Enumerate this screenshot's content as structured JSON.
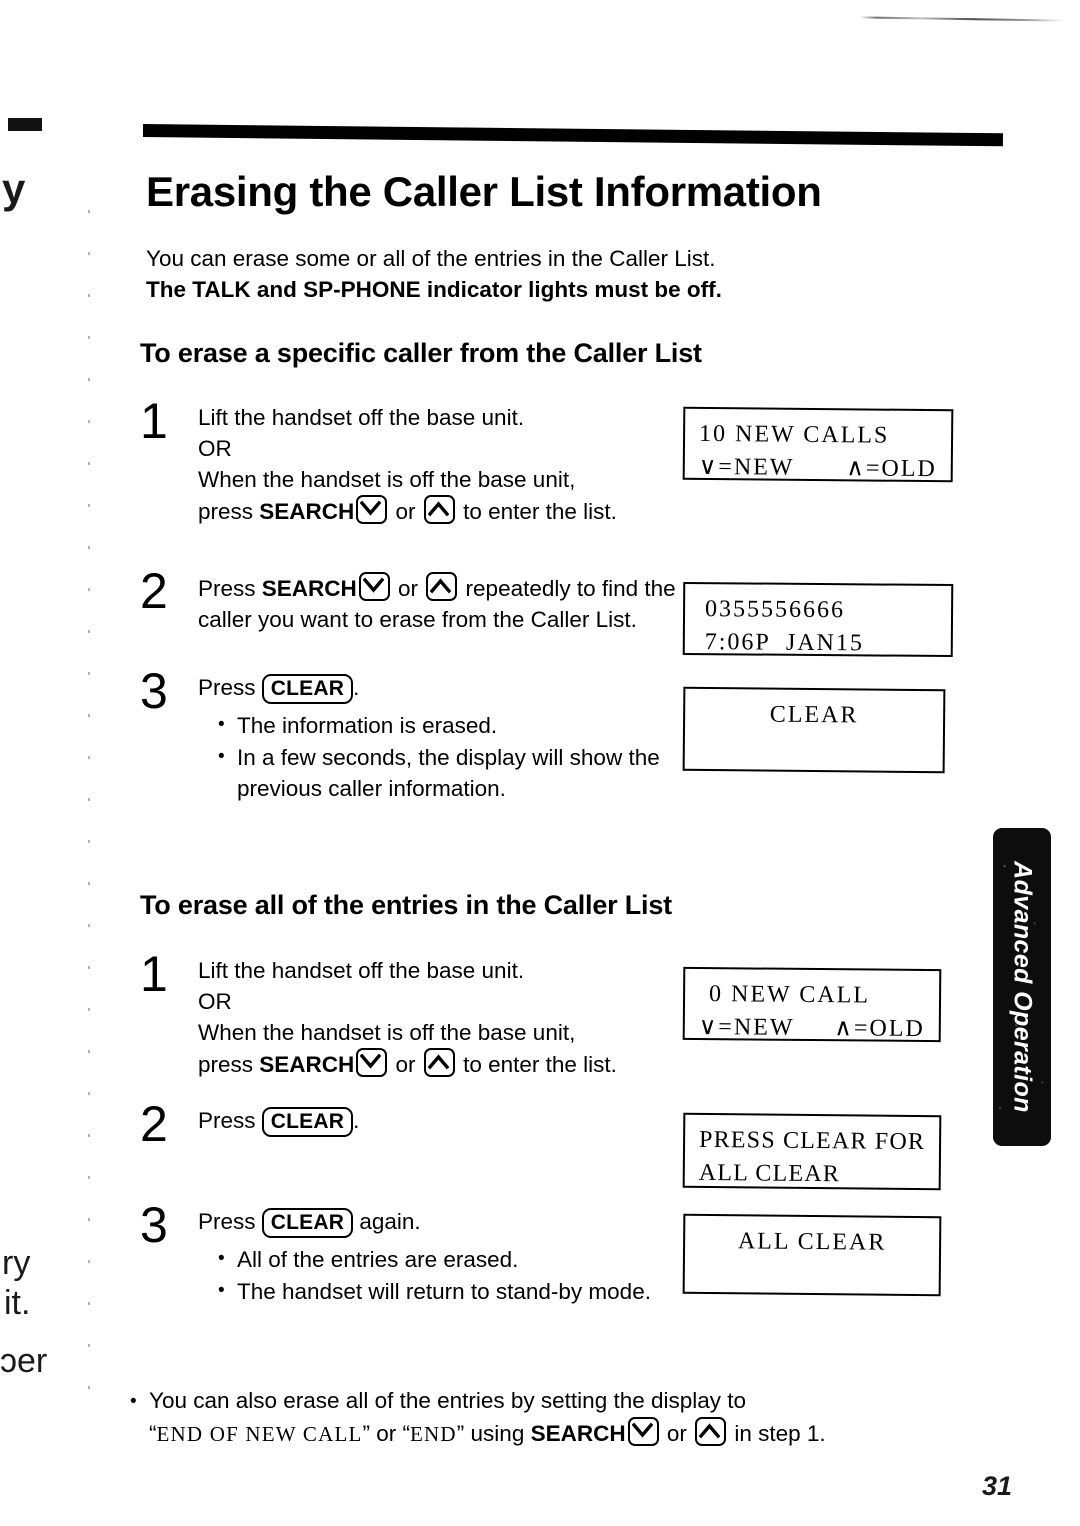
{
  "page": {
    "title": "Erasing the Caller List Information",
    "page_number": "31",
    "side_tab_label": "Advanced Operation"
  },
  "intro": {
    "line1": "You can erase some or all of the entries in the Caller List.",
    "line2": "The TALK and SP-PHONE indicator lights must be off."
  },
  "margin_fragments": {
    "frag1": "y",
    "frag2": "ry",
    "frag3": "it.",
    "frag4": "ɔer"
  },
  "keys": {
    "search_label": "SEARCH",
    "clear_label": "CLEAR",
    "down_icon": "chevron-down-key-icon",
    "up_icon": "chevron-up-key-icon"
  },
  "sections": [
    {
      "heading": "To erase a specific caller from the Caller List",
      "steps": [
        {
          "number": "1",
          "line1": "Lift the handset off the base unit.",
          "line2": "OR",
          "line3": "When the handset is off the base unit,",
          "line4_pre": "press ",
          "line4_key": "SEARCH",
          "line4_mid": " or ",
          "line4_post": " to enter the list."
        },
        {
          "number": "2",
          "pre": "Press ",
          "key": "SEARCH",
          "mid": " or ",
          "post": " repeatedly to find the caller you want to erase from the Caller List."
        },
        {
          "number": "3",
          "pre": "Press ",
          "key": "CLEAR",
          "post": ".",
          "bullets": [
            "The information is erased.",
            "In a few seconds, the display will show the previous caller information."
          ]
        }
      ]
    },
    {
      "heading": "To erase all of the entries in the Caller List",
      "steps": [
        {
          "number": "1",
          "line1": "Lift the handset off the base unit.",
          "line2": "OR",
          "line3": "When the handset is off the base unit,",
          "line4_pre": "press ",
          "line4_key": "SEARCH",
          "line4_mid": " or ",
          "line4_post": " to enter the list."
        },
        {
          "number": "2",
          "pre": "Press ",
          "key": "CLEAR",
          "post": "."
        },
        {
          "number": "3",
          "pre": "Press ",
          "key": "CLEAR",
          "post": " again.",
          "bullets": [
            "All of the entries are erased.",
            "The handset will return to stand-by mode."
          ]
        }
      ]
    }
  ],
  "displays": [
    {
      "id": "lcd1",
      "row1": "10 NEW CALLS",
      "row2_left": "∨=NEW",
      "row2_right": "∧=OLD"
    },
    {
      "id": "lcd2",
      "row1": "0355556666",
      "row2": "7:06P  JAN15"
    },
    {
      "id": "lcd3",
      "row1": "CLEAR"
    },
    {
      "id": "lcd4",
      "row1": "0 NEW CALL",
      "row2_left": "∨=NEW",
      "row2_right": "∧=OLD"
    },
    {
      "id": "lcd5",
      "row1": "PRESS CLEAR FOR",
      "row2": "ALL CLEAR"
    },
    {
      "id": "lcd6",
      "row1": "ALL CLEAR"
    }
  ],
  "footnote": {
    "part1": "You can also erase all of the entries by setting the display to",
    "quote1": "END OF NEW CALL",
    "joiner": " or ",
    "quote2": "END",
    "part2": " using ",
    "key": "SEARCH",
    "mid": " or ",
    "part3": " in step 1."
  }
}
